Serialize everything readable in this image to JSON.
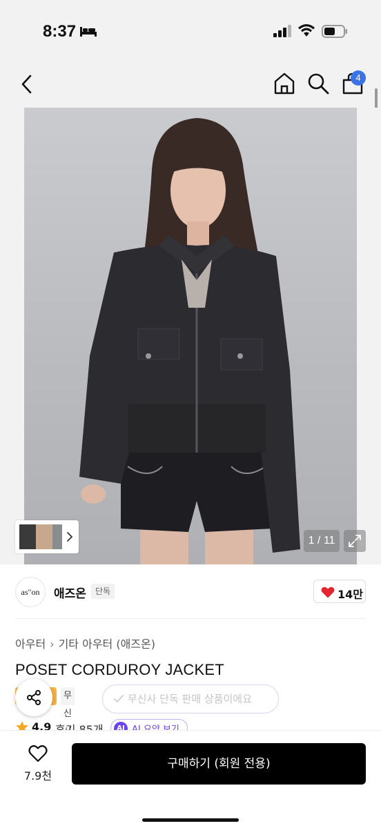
{
  "status_bar": {
    "time": "8:37"
  },
  "nav": {
    "cart_count": "4"
  },
  "gallery": {
    "counter": "1 / 11"
  },
  "brand": {
    "logo_text": "as\"on",
    "name": "애즈온",
    "tag": "단독",
    "likes": "14만"
  },
  "breadcrumb": [
    "아우터",
    "기타 아우터 (애즈온)"
  ],
  "product": {
    "title": "POSET CORDUROY JACKET",
    "badge_label": "무신사단독",
    "exclusive_tooltip": "무신사 단독 판매 상품이에요",
    "rating": "4.9",
    "reviews": "후기 85개",
    "ai_badge": "AI",
    "ai_summary": "AI 요약 보기"
  },
  "bottom_bar": {
    "wish_count": "7.9천",
    "buy_label": "구매하기 (회원 전용)"
  },
  "colors": {
    "accent_blue": "#3a73e6",
    "heart_red": "#e3262f",
    "ai_purple": "#6a42f0",
    "buy_black": "#000000"
  }
}
